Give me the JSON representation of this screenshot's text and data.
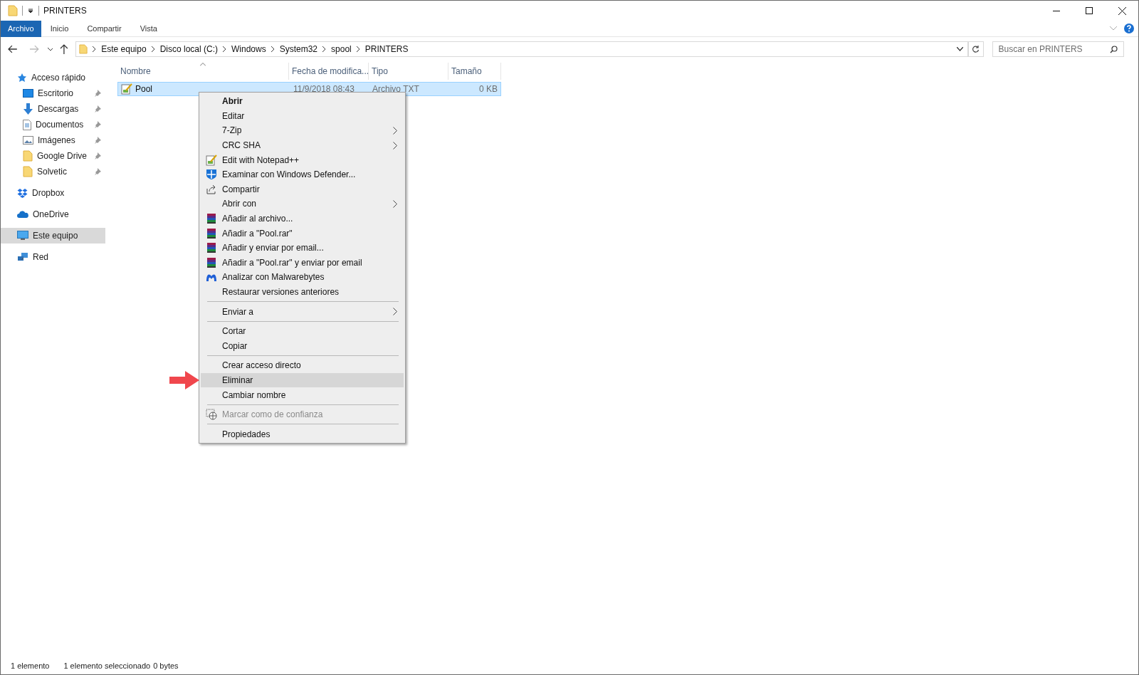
{
  "window": {
    "title": "PRINTERS"
  },
  "ribbon_tabs": [
    {
      "label": "Archivo",
      "selected": true
    },
    {
      "label": "Inicio",
      "selected": false
    },
    {
      "label": "Compartir",
      "selected": false
    },
    {
      "label": "Vista",
      "selected": false
    }
  ],
  "breadcrumb": [
    "Este equipo",
    "Disco local (C:)",
    "Windows",
    "System32",
    "spool",
    "PRINTERS"
  ],
  "search": {
    "placeholder": "Buscar en PRINTERS"
  },
  "sidebar": {
    "items": [
      {
        "label": "Acceso rápido",
        "selected": false,
        "children": [
          {
            "label": "Escritorio",
            "selected": false,
            "pinned": true
          },
          {
            "label": "Descargas",
            "selected": false,
            "pinned": true
          },
          {
            "label": "Documentos",
            "selected": false,
            "pinned": true
          },
          {
            "label": "Imágenes",
            "selected": false,
            "pinned": true
          },
          {
            "label": "Google Drive",
            "selected": false,
            "pinned": true
          },
          {
            "label": "Solvetic",
            "selected": false,
            "pinned": true
          }
        ]
      },
      {
        "label": "Dropbox",
        "selected": false
      },
      {
        "label": "OneDrive",
        "selected": false
      },
      {
        "label": "Este equipo",
        "selected": true
      },
      {
        "label": "Red",
        "selected": false
      }
    ]
  },
  "table": {
    "columns": [
      {
        "label": "Nombre",
        "sorted": true
      },
      {
        "label": "Fecha de modifica...",
        "sorted": false
      },
      {
        "label": "Tipo",
        "sorted": false
      },
      {
        "label": "Tamaño",
        "sorted": false
      }
    ],
    "rows": [
      {
        "name": "Pool",
        "date": "11/9/2018 08:43",
        "type": "Archivo TXT",
        "size": "0 KB",
        "selected": true
      }
    ]
  },
  "context_menu": [
    {
      "kind": "item",
      "label": "Abrir",
      "default": true,
      "submenu": false,
      "disabled": false,
      "selected": false
    },
    {
      "kind": "item",
      "label": "Editar",
      "default": false,
      "submenu": false,
      "disabled": false,
      "selected": false
    },
    {
      "kind": "item",
      "label": "7-Zip",
      "default": false,
      "submenu": true,
      "disabled": false,
      "selected": false
    },
    {
      "kind": "item",
      "label": "CRC SHA",
      "default": false,
      "submenu": true,
      "disabled": false,
      "selected": false
    },
    {
      "kind": "item",
      "label": "Edit with Notepad++",
      "default": false,
      "submenu": false,
      "disabled": false,
      "selected": false
    },
    {
      "kind": "item",
      "label": "Examinar con Windows Defender...",
      "default": false,
      "submenu": false,
      "disabled": false,
      "selected": false
    },
    {
      "kind": "item",
      "label": "Compartir",
      "default": false,
      "submenu": false,
      "disabled": false,
      "selected": false
    },
    {
      "kind": "item",
      "label": "Abrir con",
      "default": false,
      "submenu": true,
      "disabled": false,
      "selected": false
    },
    {
      "kind": "item",
      "label": "Añadir al archivo...",
      "default": false,
      "submenu": false,
      "disabled": false,
      "selected": false
    },
    {
      "kind": "item",
      "label": "Añadir a \"Pool.rar\"",
      "default": false,
      "submenu": false,
      "disabled": false,
      "selected": false
    },
    {
      "kind": "item",
      "label": "Añadir y enviar por email...",
      "default": false,
      "submenu": false,
      "disabled": false,
      "selected": false
    },
    {
      "kind": "item",
      "label": "Añadir a \"Pool.rar\" y enviar por email",
      "default": false,
      "submenu": false,
      "disabled": false,
      "selected": false
    },
    {
      "kind": "item",
      "label": "Analizar con Malwarebytes",
      "default": false,
      "submenu": false,
      "disabled": false,
      "selected": false
    },
    {
      "kind": "item",
      "label": "Restaurar versiones anteriores",
      "default": false,
      "submenu": false,
      "disabled": false,
      "selected": false
    },
    {
      "kind": "separator"
    },
    {
      "kind": "item",
      "label": "Enviar a",
      "default": false,
      "submenu": true,
      "disabled": false,
      "selected": false
    },
    {
      "kind": "separator"
    },
    {
      "kind": "item",
      "label": "Cortar",
      "default": false,
      "submenu": false,
      "disabled": false,
      "selected": false
    },
    {
      "kind": "item",
      "label": "Copiar",
      "default": false,
      "submenu": false,
      "disabled": false,
      "selected": false
    },
    {
      "kind": "separator"
    },
    {
      "kind": "item",
      "label": "Crear acceso directo",
      "default": false,
      "submenu": false,
      "disabled": false,
      "selected": false
    },
    {
      "kind": "item",
      "label": "Eliminar",
      "default": false,
      "submenu": false,
      "disabled": false,
      "selected": true
    },
    {
      "kind": "item",
      "label": "Cambiar nombre",
      "default": false,
      "submenu": false,
      "disabled": false,
      "selected": false
    },
    {
      "kind": "separator"
    },
    {
      "kind": "item",
      "label": "Marcar como de confianza",
      "default": false,
      "submenu": false,
      "disabled": true,
      "selected": false
    },
    {
      "kind": "separator"
    },
    {
      "kind": "item",
      "label": "Propiedades",
      "default": false,
      "submenu": false,
      "disabled": false,
      "selected": false
    }
  ],
  "status_bar": {
    "count": "1 elemento",
    "selection": "1 elemento seleccionado",
    "size": "0 bytes"
  }
}
